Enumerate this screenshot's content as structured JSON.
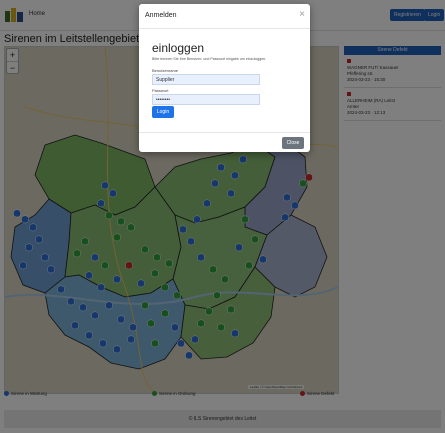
{
  "colors": {
    "primary": "#1f5fb8",
    "marker_operational": "#2a6fd6",
    "marker_defective": "#2e9e3a",
    "marker_siren_defective": "#c62828"
  },
  "navbar": {
    "logo": "logo-icon",
    "home_label": "Home",
    "register_label": "Registrieren",
    "login_label": "Login"
  },
  "page": {
    "title": "Sirenen im Leitstellengebiet der"
  },
  "map": {
    "zoom_in": "+",
    "zoom_out": "−",
    "attribution": "Leaflet | © OpenStreetMap contributors"
  },
  "legend": {
    "operational": "Sirene in Wartung",
    "defective": "Sirene in Ordnung",
    "siren_defective": "Sirene Defekt"
  },
  "side_panel": {
    "header": "Sirene Defekt",
    "entries": [
      {
        "line1": "WAGNER FUT/ Kassauer",
        "line2": "Pfeffering str.",
        "line3": "2024-03-23 · 15:30"
      },
      {
        "line1": "ALLERHEIM (RA) Leitst",
        "line2": "Amter",
        "line3": "2024-03-23 · 12:13"
      }
    ]
  },
  "footer": {
    "text": "© ILS Sirenengebiet des Leitst"
  },
  "modal": {
    "title": "Anmelden",
    "close_symbol": "×",
    "heading": "einloggen",
    "hint": "Bitte trennen Sie Ihre Benutzer- und Passwort eingabe um einzuloggen.",
    "username_label": "Benutzername",
    "username_value": "Supplier",
    "password_label": "Passwort",
    "password_value": "••••••••",
    "login_button": "Login",
    "close_button": "Close"
  }
}
